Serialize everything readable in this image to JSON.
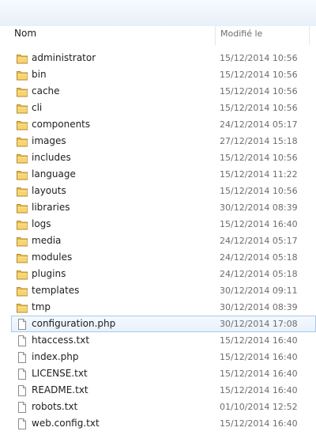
{
  "columns": {
    "name": "Nom",
    "modified": "Modifié le"
  },
  "files": [
    {
      "name": "administrator",
      "modified": "15/12/2014 10:56",
      "type": "folder"
    },
    {
      "name": "bin",
      "modified": "15/12/2014 10:56",
      "type": "folder"
    },
    {
      "name": "cache",
      "modified": "15/12/2014 10:56",
      "type": "folder"
    },
    {
      "name": "cli",
      "modified": "15/12/2014 10:56",
      "type": "folder"
    },
    {
      "name": "components",
      "modified": "24/12/2014 05:17",
      "type": "folder"
    },
    {
      "name": "images",
      "modified": "27/12/2014 15:18",
      "type": "folder"
    },
    {
      "name": "includes",
      "modified": "15/12/2014 10:56",
      "type": "folder"
    },
    {
      "name": "language",
      "modified": "15/12/2014 11:22",
      "type": "folder"
    },
    {
      "name": "layouts",
      "modified": "15/12/2014 10:56",
      "type": "folder"
    },
    {
      "name": "libraries",
      "modified": "30/12/2014 08:39",
      "type": "folder"
    },
    {
      "name": "logs",
      "modified": "15/12/2014 16:40",
      "type": "folder"
    },
    {
      "name": "media",
      "modified": "24/12/2014 05:17",
      "type": "folder"
    },
    {
      "name": "modules",
      "modified": "24/12/2014 05:18",
      "type": "folder"
    },
    {
      "name": "plugins",
      "modified": "24/12/2014 05:18",
      "type": "folder"
    },
    {
      "name": "templates",
      "modified": "30/12/2014 09:11",
      "type": "folder"
    },
    {
      "name": "tmp",
      "modified": "30/12/2014 08:39",
      "type": "folder"
    },
    {
      "name": "configuration.php",
      "modified": "30/12/2014 17:08",
      "type": "file",
      "selected": true
    },
    {
      "name": "htaccess.txt",
      "modified": "15/12/2014 16:40",
      "type": "file"
    },
    {
      "name": "index.php",
      "modified": "15/12/2014 16:40",
      "type": "file"
    },
    {
      "name": "LICENSE.txt",
      "modified": "15/12/2014 16:40",
      "type": "file"
    },
    {
      "name": "README.txt",
      "modified": "15/12/2014 16:40",
      "type": "file"
    },
    {
      "name": "robots.txt",
      "modified": "01/10/2014 12:52",
      "type": "file"
    },
    {
      "name": "web.config.txt",
      "modified": "15/12/2014 16:40",
      "type": "file"
    }
  ]
}
